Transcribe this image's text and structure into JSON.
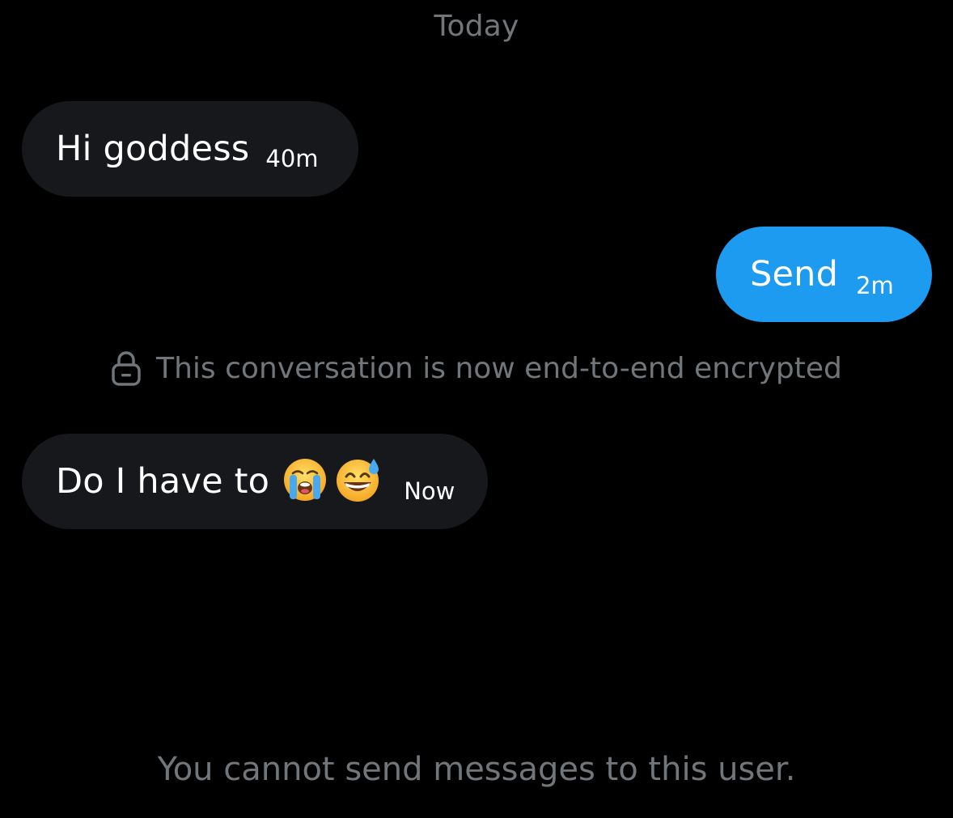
{
  "conversation": {
    "date_divider": "Today",
    "messages": [
      {
        "id": "m1",
        "direction": "received",
        "text": "Hi goddess",
        "time": "40m"
      },
      {
        "id": "m2",
        "direction": "sent",
        "text": "Send",
        "time": "2m"
      },
      {
        "id": "m3",
        "direction": "received",
        "text": "Do I have to",
        "emoji": [
          "loudly-crying-face",
          "grinning-face-with-sweat"
        ],
        "time": "Now"
      }
    ],
    "encryption_notice": "This conversation is now end-to-end encrypted",
    "encryption_icon": "lock-icon",
    "footer_notice": "You cannot send messages to this user."
  },
  "colors": {
    "background": "#000000",
    "received_bubble": "#16181c",
    "sent_bubble": "#1d9bf0",
    "muted_text": "#71767b",
    "text": "#ffffff"
  }
}
